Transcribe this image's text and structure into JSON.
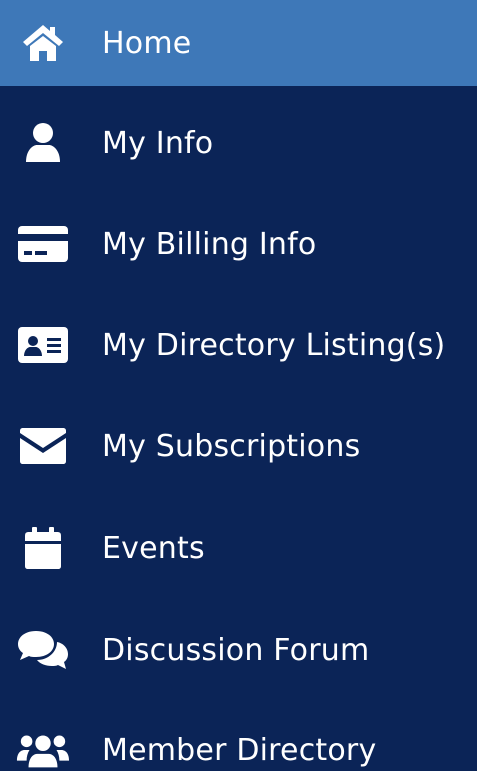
{
  "nav": {
    "items": [
      {
        "label": "Home",
        "icon": "home-icon",
        "active": true
      },
      {
        "label": "My Info",
        "icon": "user-icon",
        "active": false
      },
      {
        "label": "My Billing Info",
        "icon": "credit-card-icon",
        "active": false
      },
      {
        "label": "My Directory Listing(s)",
        "icon": "id-card-icon",
        "active": false
      },
      {
        "label": "My Subscriptions",
        "icon": "envelope-icon",
        "active": false
      },
      {
        "label": "Events",
        "icon": "calendar-icon",
        "active": false
      },
      {
        "label": "Discussion Forum",
        "icon": "comments-icon",
        "active": false
      },
      {
        "label": "Member Directory",
        "icon": "users-icon",
        "active": false
      }
    ]
  },
  "colors": {
    "sidebar_bg": "#0b2457",
    "active_bg": "#3e78b8",
    "text": "#ffffff"
  }
}
